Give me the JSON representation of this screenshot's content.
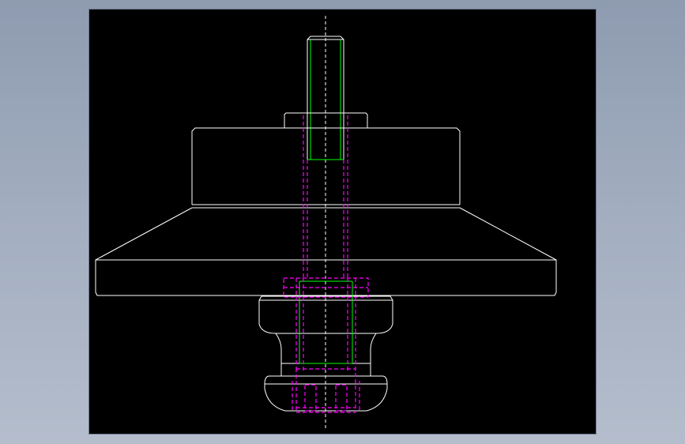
{
  "window": {
    "background_color": "#97a3b6",
    "viewport_background": "#000000"
  },
  "drawing": {
    "view": "front-view",
    "line_colors": {
      "visible_edge": "#ffffff",
      "hidden_edge": "#ff00ff",
      "thread_edge": "#00ff00",
      "center_line": "#ffffff"
    },
    "components": [
      "shaft",
      "collar",
      "upper-cylinder",
      "conical-flange",
      "flange-rim",
      "nut-upper",
      "nut-neck",
      "dome-cap"
    ]
  }
}
